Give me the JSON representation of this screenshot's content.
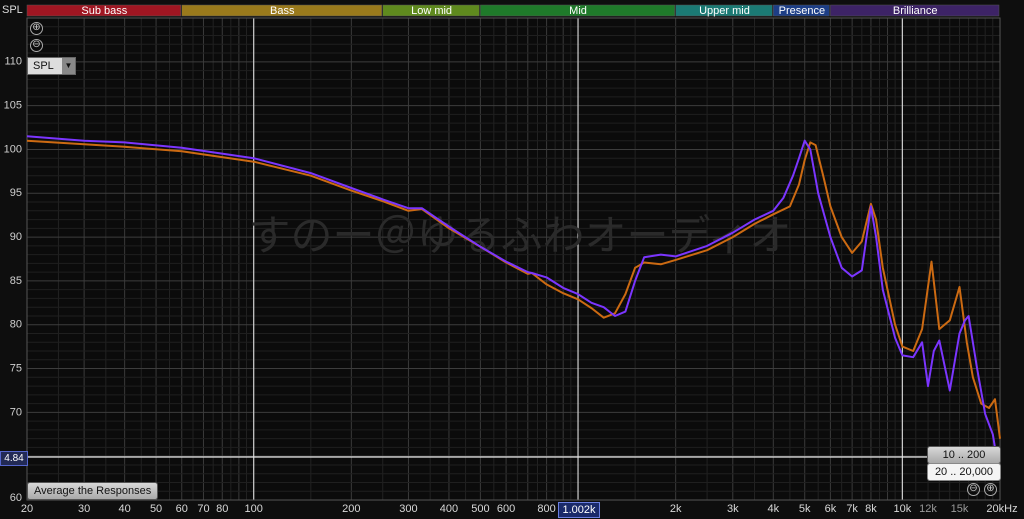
{
  "app": {
    "axis_unit_label": "SPL",
    "x_unit_label": "20kHz"
  },
  "controls": {
    "spl_select": "SPL",
    "average_button": "Average the Responses",
    "range_low": "10 .. 200",
    "range_full": "20 .. 20,000",
    "zoom_in": "⊕",
    "zoom_out": "⊖",
    "zoom_in_bottom": "⊕",
    "zoom_out_bottom": "⊖"
  },
  "cursor": {
    "y_value": "4.84",
    "x_value": "1.002k"
  },
  "bands": [
    {
      "label": "Sub bass",
      "from": 20,
      "to": 60,
      "color": "#a01622"
    },
    {
      "label": "Bass",
      "from": 60,
      "to": 250,
      "color": "#9a7a1c"
    },
    {
      "label": "Low mid",
      "from": 250,
      "to": 500,
      "color": "#5f8a1e"
    },
    {
      "label": "Mid",
      "from": 500,
      "to": 2000,
      "color": "#1f7a2a"
    },
    {
      "label": "Upper mid",
      "from": 2000,
      "to": 4000,
      "color": "#1b7a74"
    },
    {
      "label": "Presence",
      "from": 4000,
      "to": 6000,
      "color": "#1d3e86"
    },
    {
      "label": "Brilliance",
      "from": 6000,
      "to": 20000,
      "color": "#3d2366"
    }
  ],
  "watermark": "すのー＠ゆるふわオーディオ",
  "chart_data": {
    "type": "line",
    "xscale": "log",
    "xlim": [
      20,
      20000
    ],
    "ylim": [
      60,
      115
    ],
    "ylabel": "SPL",
    "grid": true,
    "y_ticks": [
      60,
      65,
      70,
      75,
      80,
      85,
      90,
      95,
      100,
      105,
      110
    ],
    "x_ticks_major": [
      {
        "v": 20,
        "t": "20"
      },
      {
        "v": 30,
        "t": "30"
      },
      {
        "v": 40,
        "t": "40"
      },
      {
        "v": 50,
        "t": "50"
      },
      {
        "v": 60,
        "t": "60"
      },
      {
        "v": 70,
        "t": "70"
      },
      {
        "v": 80,
        "t": "80"
      },
      {
        "v": 100,
        "t": "100"
      },
      {
        "v": 200,
        "t": "200"
      },
      {
        "v": 300,
        "t": "300"
      },
      {
        "v": 400,
        "t": "400"
      },
      {
        "v": 500,
        "t": "500"
      },
      {
        "v": 600,
        "t": "600"
      },
      {
        "v": 800,
        "t": "800"
      },
      {
        "v": 2000,
        "t": "2k"
      },
      {
        "v": 3000,
        "t": "3k"
      },
      {
        "v": 4000,
        "t": "4k"
      },
      {
        "v": 5000,
        "t": "5k"
      },
      {
        "v": 6000,
        "t": "6k"
      },
      {
        "v": 7000,
        "t": "7k"
      },
      {
        "v": 8000,
        "t": "8k"
      },
      {
        "v": 10000,
        "t": "10k"
      }
    ],
    "x_ticks_minor": [
      {
        "v": 12000,
        "t": "12k"
      },
      {
        "v": 15000,
        "t": "15k"
      }
    ],
    "vertical_markers": [
      100,
      1000,
      10000
    ],
    "series": [
      {
        "color": "#cc6a12",
        "x": [
          20,
          30,
          40,
          60,
          100,
          150,
          200,
          250,
          300,
          330,
          400,
          500,
          600,
          700,
          720,
          800,
          900,
          1000,
          1100,
          1200,
          1300,
          1400,
          1500,
          1600,
          1800,
          2000,
          2500,
          3000,
          3500,
          4000,
          4500,
          4800,
          5000,
          5200,
          5400,
          5700,
          6000,
          6500,
          7000,
          7500,
          8000,
          8300,
          8700,
          9500,
          10000,
          10800,
          11500,
          12300,
          13000,
          14000,
          15000,
          15800,
          16500,
          17500,
          18500,
          19300,
          20000
        ],
        "y": [
          101.0,
          100.6,
          100.3,
          99.8,
          98.6,
          97.0,
          95.3,
          94.1,
          93.0,
          93.2,
          91.0,
          88.9,
          87.1,
          85.8,
          85.9,
          84.6,
          83.6,
          82.9,
          81.9,
          80.8,
          81.3,
          83.5,
          86.5,
          87.1,
          86.9,
          87.4,
          88.5,
          90.0,
          91.5,
          92.6,
          93.5,
          96.0,
          98.8,
          100.8,
          100.5,
          97.0,
          93.5,
          90.0,
          88.2,
          89.5,
          93.8,
          92.0,
          86.5,
          80.0,
          77.5,
          77.0,
          79.5,
          87.2,
          79.5,
          80.5,
          84.3,
          78.0,
          74.0,
          71.0,
          70.5,
          71.5,
          67.0
        ]
      },
      {
        "color": "#7b35ff",
        "x": [
          20,
          30,
          40,
          60,
          100,
          150,
          200,
          250,
          300,
          330,
          400,
          500,
          600,
          700,
          720,
          800,
          900,
          1000,
          1100,
          1200,
          1300,
          1400,
          1500,
          1600,
          1800,
          2000,
          2500,
          3000,
          3500,
          4000,
          4300,
          4600,
          4800,
          5000,
          5200,
          5500,
          6000,
          6500,
          7000,
          7500,
          8000,
          8300,
          8700,
          9500,
          10000,
          10800,
          11500,
          12000,
          12500,
          13000,
          14000,
          15000,
          15600,
          16000,
          17000,
          18000,
          19000,
          20000
        ],
        "y": [
          101.5,
          101.0,
          100.8,
          100.2,
          99.0,
          97.3,
          95.6,
          94.3,
          93.3,
          93.3,
          91.2,
          88.9,
          87.2,
          86.0,
          85.9,
          85.4,
          84.2,
          83.5,
          82.5,
          82.0,
          81.0,
          81.5,
          85.0,
          87.7,
          88.0,
          87.8,
          89.0,
          90.5,
          92.0,
          93.0,
          94.5,
          97.0,
          99.0,
          101.0,
          100.0,
          95.0,
          90.0,
          86.5,
          85.5,
          86.2,
          93.5,
          90.0,
          84.0,
          78.5,
          76.5,
          76.3,
          78.0,
          73.0,
          77.0,
          78.2,
          72.5,
          79.0,
          80.5,
          81.0,
          75.0,
          69.8,
          67.5,
          62.5
        ]
      }
    ]
  }
}
